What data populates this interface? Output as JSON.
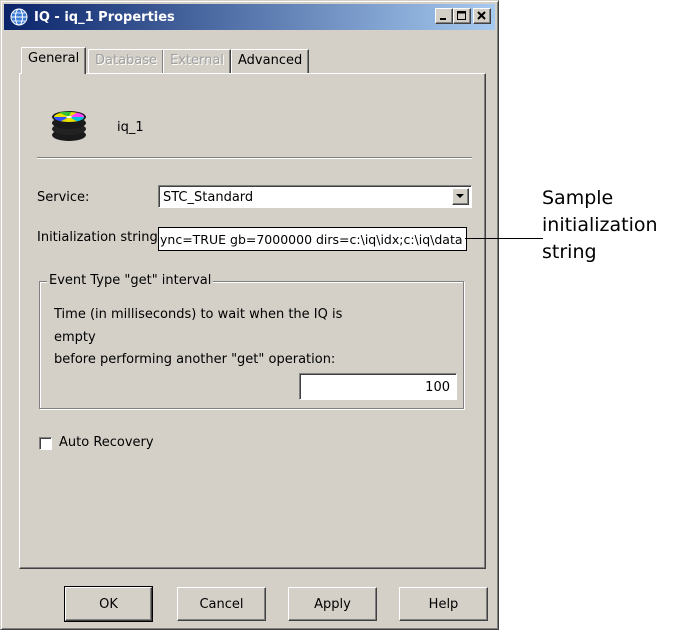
{
  "window": {
    "title": "IQ - iq_1 Properties"
  },
  "tabs": [
    {
      "label": "General",
      "state": "active"
    },
    {
      "label": "Database",
      "state": "disabled"
    },
    {
      "label": "External",
      "state": "disabled"
    },
    {
      "label": "Advanced",
      "state": "enabled"
    }
  ],
  "general": {
    "icon": "database-icon",
    "queue_name": "iq_1",
    "service_label": "Service:",
    "service_value": "STC_Standard",
    "init_label": "Initialization string:",
    "init_value": "ync=TRUE gb=7000000 dirs=c:\\iq\\idx;c:\\iq\\data",
    "group_title": "Event Type \"get\" interval",
    "interval_line1": "Time (in milliseconds) to wait when the IQ is",
    "interval_line2": "empty",
    "interval_line3": "before performing another \"get\" operation:",
    "interval_value": "100",
    "auto_recovery_label": "Auto Recovery",
    "auto_recovery_checked": false
  },
  "buttons": {
    "ok": "OK",
    "cancel": "Cancel",
    "apply": "Apply",
    "help": "Help"
  },
  "callout": {
    "line1": "Sample",
    "line2": "initialization",
    "line3": "string"
  },
  "colors": {
    "titlebar_start": "#0a246a",
    "titlebar_end": "#a6caf0",
    "face": "#d4d0c8"
  }
}
